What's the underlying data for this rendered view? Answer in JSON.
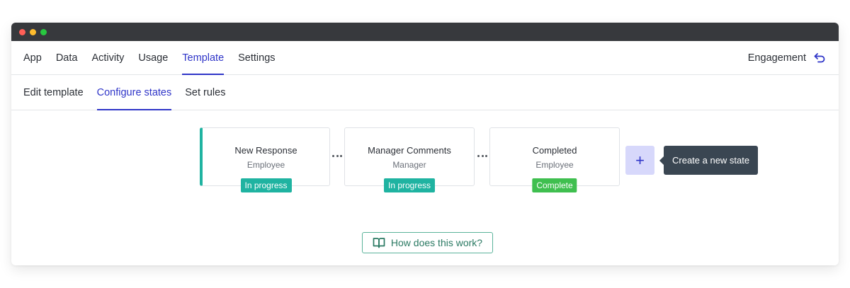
{
  "window": {
    "controls": [
      "close",
      "minimize",
      "maximize"
    ]
  },
  "top_nav": {
    "tabs": [
      {
        "label": "App"
      },
      {
        "label": "Data"
      },
      {
        "label": "Activity"
      },
      {
        "label": "Usage"
      },
      {
        "label": "Template",
        "active": true
      },
      {
        "label": "Settings"
      }
    ],
    "context_label": "Engagement",
    "back_icon": "back-arrow-icon"
  },
  "sub_nav": {
    "tabs": [
      {
        "label": "Edit template"
      },
      {
        "label": "Configure states",
        "active": true
      },
      {
        "label": "Set rules"
      }
    ]
  },
  "states": [
    {
      "name": "New Response",
      "role": "Employee",
      "status": "In progress",
      "status_color": "#1fb3a1"
    },
    {
      "name": "Manager Comments",
      "role": "Manager",
      "status": "In progress",
      "status_color": "#1fb3a1"
    },
    {
      "name": "Completed",
      "role": "Employee",
      "status": "Complete",
      "status_color": "#3fbf4f"
    }
  ],
  "add_state": {
    "label": "+",
    "tooltip": "Create a new state"
  },
  "help": {
    "label": "How does this work?",
    "icon": "book-icon"
  },
  "colors": {
    "accent": "#2f35c8",
    "teal": "#1fb3a1",
    "green": "#3fbf4f",
    "tooltip_bg": "#3a4652"
  }
}
